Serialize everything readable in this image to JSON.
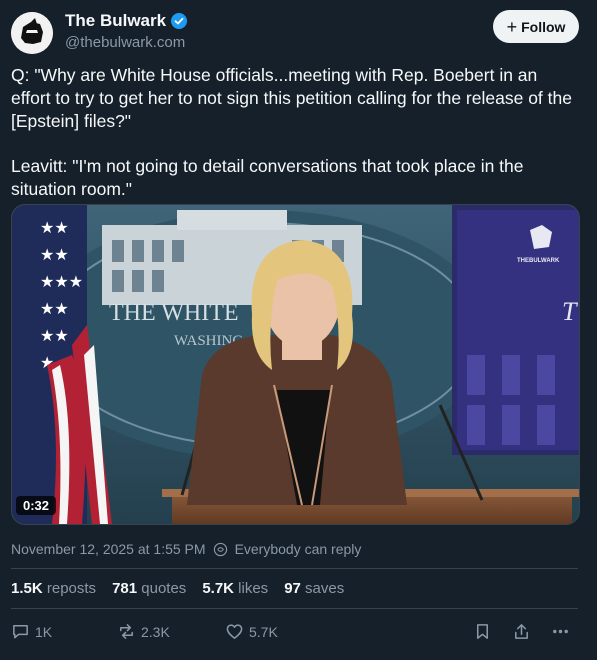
{
  "account": {
    "name": "The Bulwark",
    "handle": "@thebulwark.com"
  },
  "follow_button": {
    "label": "Follow"
  },
  "post": {
    "paragraphs": [
      "Q: \"Why are White House officials...meeting with Rep. Boebert in an effort to try to get her to not sign this petition calling for the release of the [Epstein] files?\"",
      "Leavitt: \"I'm not going to detail conversations that took place in the situation room.\""
    ],
    "video": {
      "duration": "0:32",
      "background_text": "THE WHITE",
      "background_subtext": "WASHING",
      "screen_logo_text": "THEBULWARK",
      "screen_letter": "T"
    },
    "timestamp": "November 12, 2025 at 1:55 PM",
    "reply_setting": "Everybody can reply"
  },
  "stats": {
    "reposts_count": "1.5K",
    "reposts_label": "reposts",
    "quotes_count": "781",
    "quotes_label": "quotes",
    "likes_count": "5.7K",
    "likes_label": "likes",
    "saves_count": "97",
    "saves_label": "saves"
  },
  "actions": {
    "replies": "1K",
    "reposts": "2.3K",
    "likes": "5.7K"
  },
  "colors": {
    "background": "#15202b",
    "text": "#f7f9f9",
    "muted": "#8b98a5",
    "verified": "#1d9bf0",
    "follow_bg": "#eff3f4"
  }
}
